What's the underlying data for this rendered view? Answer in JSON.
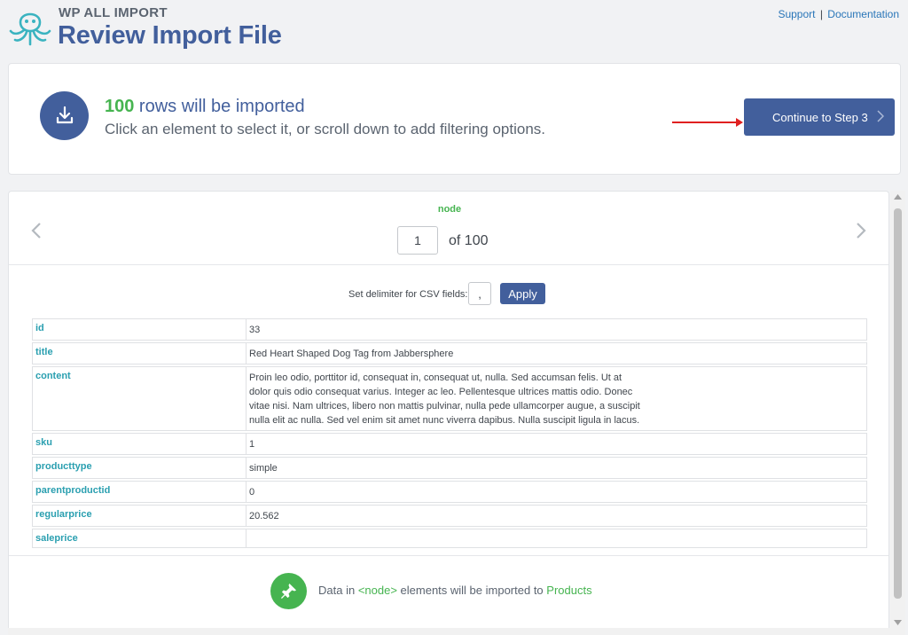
{
  "header": {
    "brand": "WP ALL IMPORT",
    "title": "Review Import File",
    "links": {
      "support": "Support",
      "separator": "|",
      "documentation": "Documentation"
    }
  },
  "summary": {
    "count": "100",
    "rows_text": " rows will be imported",
    "instruction": "Click an element to select it, or scroll down to add filtering options.",
    "continue_label": "Continue to Step 3"
  },
  "review": {
    "node_label": "node",
    "page_current": "1",
    "page_of": "of 100",
    "delimiter_label": "Set delimiter for CSV fields:",
    "delimiter_value": ",",
    "apply_label": "Apply",
    "rows": [
      {
        "key": "id",
        "value": "33"
      },
      {
        "key": "title",
        "value": "Red Heart Shaped Dog Tag from Jabbersphere"
      },
      {
        "key": "content",
        "value": "Proin leo odio, porttitor id, consequat in, consequat ut, nulla. Sed accumsan felis. Ut at dolor quis odio consequat varius. Integer ac leo. Pellentesque ultrices mattis odio. Donec vitae nisi. Nam ultrices, libero non mattis pulvinar, nulla pede ullamcorper augue, a suscipit nulla elit ac nulla. Sed vel enim sit amet nunc viverra dapibus. Nulla suscipit ligula in lacus."
      },
      {
        "key": "sku",
        "value": "1"
      },
      {
        "key": "producttype",
        "value": "simple"
      },
      {
        "key": "parentproductid",
        "value": "0"
      },
      {
        "key": "regularprice",
        "value": "20.562"
      },
      {
        "key": "saleprice",
        "value": ""
      }
    ],
    "note_prefix": "Data in ",
    "note_node": "<node>",
    "note_middle": " elements will be imported to ",
    "note_target": "Products"
  },
  "colors": {
    "brand_blue": "#425f9c",
    "accent_green": "#46b450",
    "key_teal": "#2a9fb0",
    "link_blue": "#2a76b8",
    "arrow_red": "#e02020"
  },
  "icons": {
    "logo": "octopus-logo-icon",
    "download": "download-icon",
    "prev": "chevron-left-icon",
    "next": "chevron-right-icon",
    "pin": "pushpin-icon"
  }
}
